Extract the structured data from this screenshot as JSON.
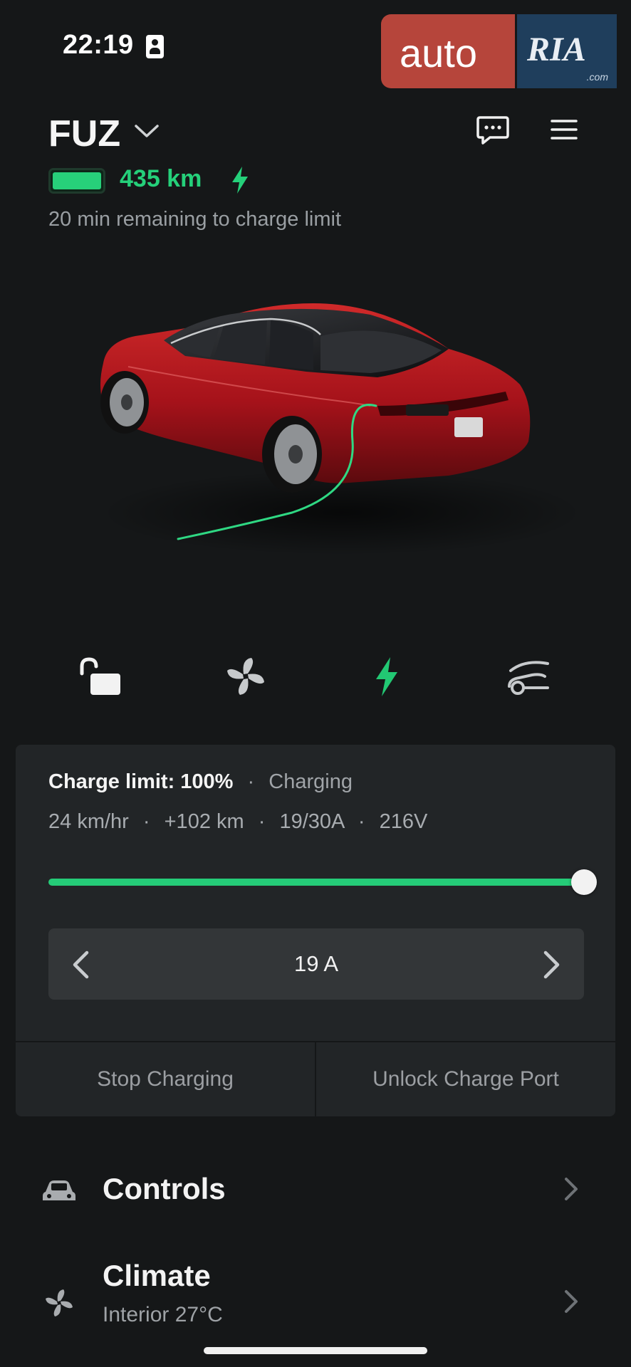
{
  "status_bar": {
    "time": "22:19",
    "id_icon": "person-card-icon"
  },
  "watermark": {
    "brand_left": "auto",
    "brand_right": "RIA",
    "domain": ".com"
  },
  "header": {
    "car_name": "FUZ",
    "range": "435 km",
    "battery_level": 1.0,
    "charge_remaining": "20 min remaining to charge limit"
  },
  "quick_actions": [
    {
      "name": "unlock",
      "icon": "unlocked-padlock-icon"
    },
    {
      "name": "climate",
      "icon": "fan-icon"
    },
    {
      "name": "charging",
      "icon": "lightning-bolt-icon",
      "active": true
    },
    {
      "name": "frunk",
      "icon": "car-frunk-icon"
    }
  ],
  "charge_card": {
    "limit_label": "Charge limit: 100%",
    "separator": "·",
    "status": "Charging",
    "rate": "24 km/hr",
    "added": "+102 km",
    "current": "19/30A",
    "voltage": "216V",
    "limit_value": 1.0,
    "amps_value": "19 A",
    "stop_label": "Stop Charging",
    "unlock_port_label": "Unlock Charge Port"
  },
  "menu": {
    "controls": {
      "label": "Controls",
      "icon": "car-icon"
    },
    "climate": {
      "label": "Climate",
      "sub": "Interior 27°C",
      "icon": "fan-icon"
    }
  },
  "colors": {
    "background": "#151718",
    "card": "#222527",
    "accent_green": "#25d07a",
    "car_red": "#b4141b"
  }
}
